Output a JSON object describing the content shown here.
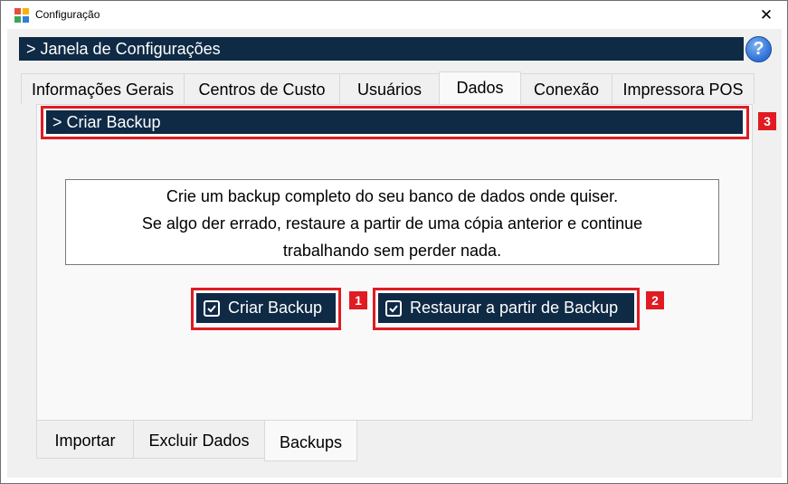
{
  "window": {
    "title": "Configuração",
    "close_glyph": "✕",
    "app_icon": "app-logo-icon"
  },
  "header": {
    "title": "> Janela de Configurações",
    "help_glyph": "?"
  },
  "top_tabs": [
    {
      "label": "Informações Gerais",
      "active": false
    },
    {
      "label": "Centros de Custo",
      "active": false
    },
    {
      "label": "Usuários",
      "active": false
    },
    {
      "label": "Dados",
      "active": true
    },
    {
      "label": "Conexão",
      "active": false
    },
    {
      "label": "Impressora POS",
      "active": false
    }
  ],
  "section": {
    "title": "> Criar Backup"
  },
  "description": {
    "line1": "Crie um backup completo do seu banco de dados onde quiser.",
    "line2": "Se algo der errado, restaure a partir de uma cópia anterior e continue",
    "line3": "trabalhando sem perder nada."
  },
  "buttons": {
    "create_backup": "Criar Backup",
    "restore_backup": "Restaurar a partir de Backup"
  },
  "annotations": {
    "badge1": "1",
    "badge2": "2",
    "badge3": "3",
    "highlight_color": "#e01b22"
  },
  "bottom_tabs": [
    {
      "label": "Importar",
      "active": false
    },
    {
      "label": "Excluir Dados",
      "active": false
    },
    {
      "label": "Backups",
      "active": true
    }
  ],
  "colors": {
    "navy": "#0e2a45",
    "panel": "#f9f9f9",
    "window_bg": "#f0f0f0"
  }
}
